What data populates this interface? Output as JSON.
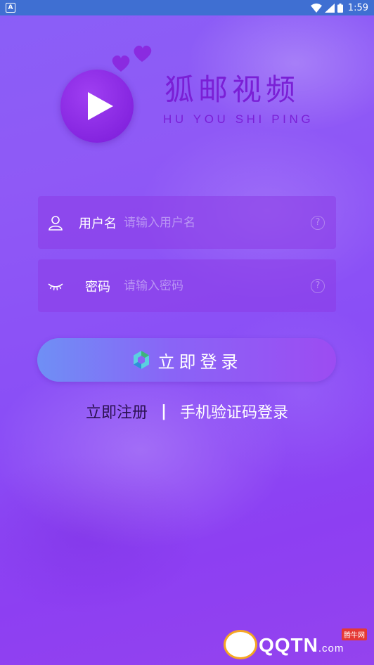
{
  "status_bar": {
    "time": "1:59",
    "app_badge": "A"
  },
  "app": {
    "name": "狐邮视频",
    "subtitle": "HU YOU SHI PING"
  },
  "form": {
    "username": {
      "label": "用户名",
      "placeholder": "请输入用户名",
      "help": "?"
    },
    "password": {
      "label": "密码",
      "placeholder": "请输入密码",
      "help": "?"
    },
    "login_button": "立即登录"
  },
  "links": {
    "register": "立即注册",
    "separator": "|",
    "sms_login": "手机验证码登录"
  },
  "watermark": {
    "brand": "QQTN",
    "suffix": ".com",
    "tag": "腾牛网"
  },
  "colors": {
    "accent": "#7a1fd6",
    "status_bar": "#3f6fd2",
    "button_start": "#6f8ff5",
    "button_end": "#9c4cf2"
  }
}
